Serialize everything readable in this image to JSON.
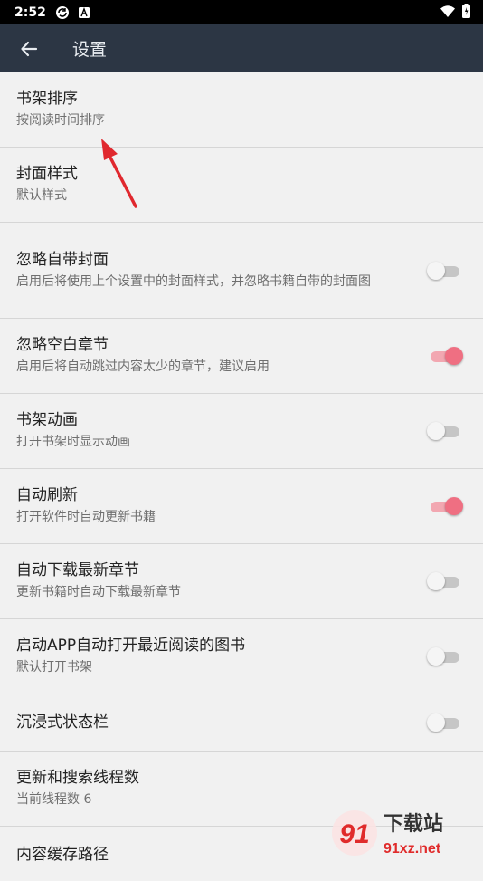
{
  "status_bar": {
    "time": "2:52",
    "icons": [
      "rotate-icon",
      "a-badge-icon",
      "wifi-icon",
      "battery-icon"
    ]
  },
  "app_bar": {
    "title": "设置",
    "back_icon": "arrow-left-icon"
  },
  "settings": [
    {
      "title": "书架排序",
      "subtitle": "按阅读时间排序"
    },
    {
      "title": "封面样式",
      "subtitle": "默认样式"
    },
    {
      "title": "忽略自带封面",
      "subtitle": "启用后将使用上个设置中的封面样式，并忽略书籍自带的封面图",
      "toggle": false
    },
    {
      "title": "忽略空白章节",
      "subtitle": "启用后将自动跳过内容太少的章节，建议启用",
      "toggle": true
    },
    {
      "title": "书架动画",
      "subtitle": "打开书架时显示动画",
      "toggle": false
    },
    {
      "title": "自动刷新",
      "subtitle": "打开软件时自动更新书籍",
      "toggle": true
    },
    {
      "title": "自动下载最新章节",
      "subtitle": "更新书籍时自动下载最新章节",
      "toggle": false
    },
    {
      "title": "启动APP自动打开最近阅读的图书",
      "subtitle": "默认打开书架",
      "toggle": false
    },
    {
      "title": "沉浸式状态栏",
      "subtitle": "",
      "toggle": false
    },
    {
      "title": "更新和搜索线程数",
      "subtitle": "当前线程数 6"
    },
    {
      "title": "内容缓存路径",
      "subtitle": ""
    }
  ],
  "watermark": {
    "logo": "91",
    "cn": "下载站",
    "url": "91xz.net"
  },
  "colors": {
    "app_bar": "#2c3644",
    "toggle_on": "#ef6f82",
    "annotation_arrow": "#e0282e"
  }
}
